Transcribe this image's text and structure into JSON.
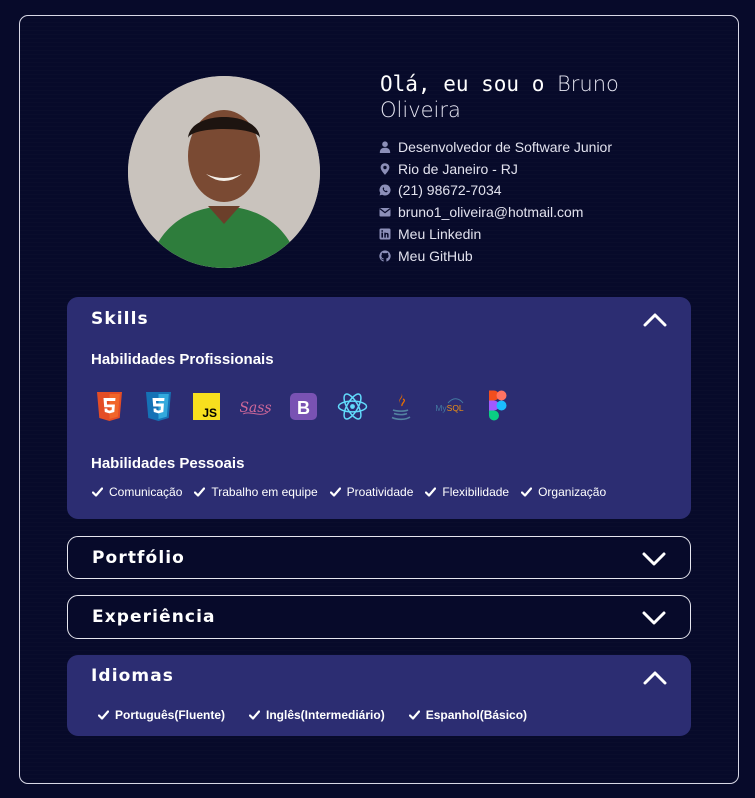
{
  "profile": {
    "greeting_prefix": "Olá, eu sou o ",
    "name": "Bruno Oliveira",
    "info": [
      {
        "icon": "user-icon",
        "text": "Desenvolvedor de Software Junior"
      },
      {
        "icon": "location-pin-icon",
        "text": "Rio de Janeiro - RJ"
      },
      {
        "icon": "whatsapp-icon",
        "text": "(21) 98672-7034"
      },
      {
        "icon": "envelope-icon",
        "text": "bruno1_oliveira@hotmail.com"
      },
      {
        "icon": "linkedin-icon",
        "text": "Meu Linkedin"
      },
      {
        "icon": "github-icon",
        "text": "Meu GitHub"
      }
    ]
  },
  "skills": {
    "title": "Skills",
    "expanded": true,
    "professional_heading": "Habilidades Profissionais",
    "technologies": [
      "html5-icon",
      "css3-icon",
      "javascript-icon",
      "sass-icon",
      "bootstrap-icon",
      "react-icon",
      "java-icon",
      "mysql-icon",
      "figma-icon"
    ],
    "personal_heading": "Habilidades Pessoais",
    "personal": [
      "Comunicação",
      "Trabalho em equipe",
      "Proatividade",
      "Flexibilidade",
      "Organização"
    ]
  },
  "portfolio": {
    "title": "Portfólio",
    "expanded": false
  },
  "experience": {
    "title": "Experiência",
    "expanded": false
  },
  "languages": {
    "title": "Idiomas",
    "expanded": true,
    "items": [
      "Português(Fluente)",
      "Inglês(Intermediário)",
      "Espanhol(Básico)"
    ]
  },
  "colors": {
    "background": "#070a2a",
    "panel": "#2c2d72",
    "text": "#ffffff",
    "icon_muted": "#8c8fb8"
  }
}
